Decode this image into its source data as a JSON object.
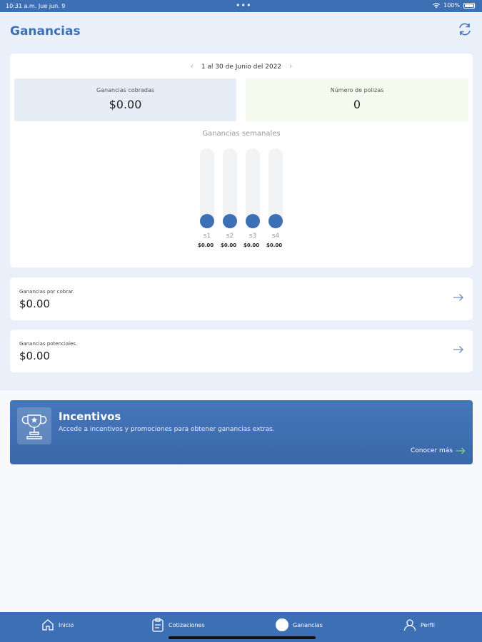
{
  "status_bar": {
    "time": "10:31 a.m.  Jue jun. 9",
    "dots": "•••",
    "battery": "100%"
  },
  "header": {
    "title": "Ganancias",
    "refresh_icon": "refresh-icon"
  },
  "summary": {
    "period": "1 al 30 de Junio del 2022",
    "prev_arrow": "‹",
    "next_arrow": "›",
    "cobradas": {
      "label": "Ganancias cobradas",
      "value": "$0.00"
    },
    "polizas": {
      "label": "Número de polizas",
      "value": "0"
    },
    "weekly_title": "Ganancias semanales",
    "weeks": [
      {
        "label": "s1",
        "value": "$0.00",
        "fill": 0
      },
      {
        "label": "s2",
        "value": "$0.00",
        "fill": 0
      },
      {
        "label": "s3",
        "value": "$0.00",
        "fill": 0
      },
      {
        "label": "s4",
        "value": "$0.00",
        "fill": 0
      }
    ]
  },
  "por_cobrar": {
    "label": "Ganancias por cobrar.",
    "value": "$0.00"
  },
  "potenciales": {
    "label": "Ganancias potenciales.",
    "value": "$0.00"
  },
  "incentivos": {
    "title": "Incentivos",
    "description": "Accede a incentivos y promociones para obtener ganancias extras.",
    "link": "Conocer más",
    "icon": "trophy-icon"
  },
  "tabs": [
    {
      "label": "Inicio",
      "icon": "home-icon"
    },
    {
      "label": "Cotizaciones",
      "icon": "clipboard-icon"
    },
    {
      "label": "Ganancias",
      "icon": "active-dot"
    },
    {
      "label": "Perfil",
      "icon": "user-icon"
    }
  ],
  "colors": {
    "brand": "#3d6fb4",
    "cobradas_bg": "#e6edf7",
    "polizas_bg": "#f4fbee",
    "link_arrow": "#7fd67f"
  }
}
